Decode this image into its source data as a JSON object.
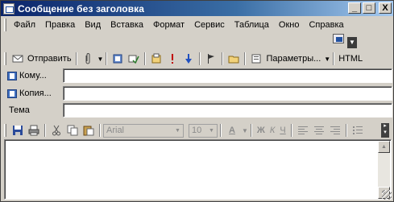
{
  "window": {
    "title": "Сообщение без заголовка",
    "minimize_glyph": "_",
    "maximize_glyph": "□",
    "close_glyph": "X"
  },
  "menu": [
    {
      "label": "Файл"
    },
    {
      "label": "Правка"
    },
    {
      "label": "Вид"
    },
    {
      "label": "Вставка"
    },
    {
      "label": "Формат"
    },
    {
      "label": "Сервис"
    },
    {
      "label": "Таблица"
    },
    {
      "label": "Окно"
    },
    {
      "label": "Справка"
    }
  ],
  "toolbar": {
    "send_label": "Отправить",
    "options_label": "Параметры...",
    "format_label": "HTML"
  },
  "address": {
    "to_label": "Кому...",
    "cc_label": "Копия...",
    "subject_label": "Тема",
    "to_value": "",
    "cc_value": "",
    "subject_value": ""
  },
  "format_toolbar": {
    "font_name": "Arial",
    "font_size": "10",
    "bold_glyph": "Ж",
    "italic_glyph": "К",
    "underline_glyph": "Ч"
  },
  "icons": {
    "title": "outlook-message-icon",
    "send": "send-icon",
    "attach": "paperclip-icon",
    "flag": "flag-icon",
    "priority_high": "exclamation-icon",
    "priority_low": "down-arrow-icon",
    "address_book": "address-book-icon",
    "save": "save-icon",
    "print": "printer-icon",
    "cut": "scissors-icon",
    "copy": "copy-icon",
    "paste": "paste-icon"
  },
  "colors": {
    "titlebar_start": "#0a246a",
    "titlebar_end": "#a6caf0",
    "face": "#d4d0c8"
  }
}
